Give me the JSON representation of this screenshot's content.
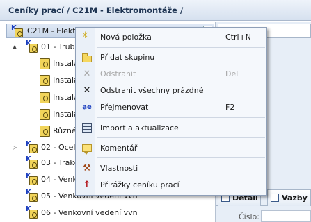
{
  "window": {
    "title": "Ceníky prací / C21M - Elektromontáže /"
  },
  "tree": {
    "selector_label": "C21M - Elektromontáže",
    "rows": [
      {
        "label": "01 - Trubkové vedení",
        "expander": "▲",
        "kind": "k"
      },
      {
        "label": "Instalační trubky",
        "kind": "file"
      },
      {
        "label": "Instalační lišty",
        "kind": "file"
      },
      {
        "label": "Instalační kanály",
        "kind": "file"
      },
      {
        "label": "Instalační krabice",
        "kind": "file"
      },
      {
        "label": "Různé",
        "kind": "file"
      },
      {
        "label": "02 - Ocelové konstrukce",
        "expander": "▷",
        "kind": "k"
      },
      {
        "label": "03 - Trakční vedení",
        "kind": "k"
      },
      {
        "label": "04 - Venkovní vedení",
        "kind": "k"
      },
      {
        "label": "05 - Venkovní vedení vvn",
        "kind": "k"
      },
      {
        "label": "06 - Venkovní vedení vvn",
        "kind": "k"
      }
    ]
  },
  "right_panel": {
    "tabs": [
      {
        "label": "Detail"
      },
      {
        "label": "Vazby"
      }
    ],
    "cislo_label": "Číslo:"
  },
  "context_menu": {
    "items": [
      {
        "label": "Nová položka",
        "shortcut": "Ctrl+N",
        "icon": "new-item-icon",
        "enabled": true
      },
      {
        "label": "Přidat skupinu",
        "shortcut": "",
        "icon": "add-group-folder-icon",
        "enabled": true
      },
      {
        "label": "Odstranit",
        "shortcut": "Del",
        "icon": "delete-x-icon",
        "enabled": false
      },
      {
        "label": "Odstranit všechny prázdné",
        "shortcut": "",
        "icon": "delete-all-empty-icon",
        "enabled": true
      },
      {
        "label": "Přejmenovat",
        "shortcut": "F2",
        "icon": "rename-icon",
        "enabled": true
      },
      {
        "label": "Import a aktualizace",
        "shortcut": "",
        "icon": "import-icon",
        "enabled": true
      },
      {
        "label": "Komentář",
        "shortcut": "",
        "icon": "comment-icon",
        "enabled": true
      },
      {
        "label": "Vlastnosti",
        "shortcut": "",
        "icon": "properties-tools-icon",
        "enabled": true
      },
      {
        "label": "Přirážky ceníku prací",
        "shortcut": "",
        "icon": "surcharges-icon",
        "enabled": true
      }
    ]
  },
  "colors": {
    "accent": "#1c3fbf",
    "menu_background": "#f5f8fc",
    "disabled_text": "#a7a7a7"
  }
}
